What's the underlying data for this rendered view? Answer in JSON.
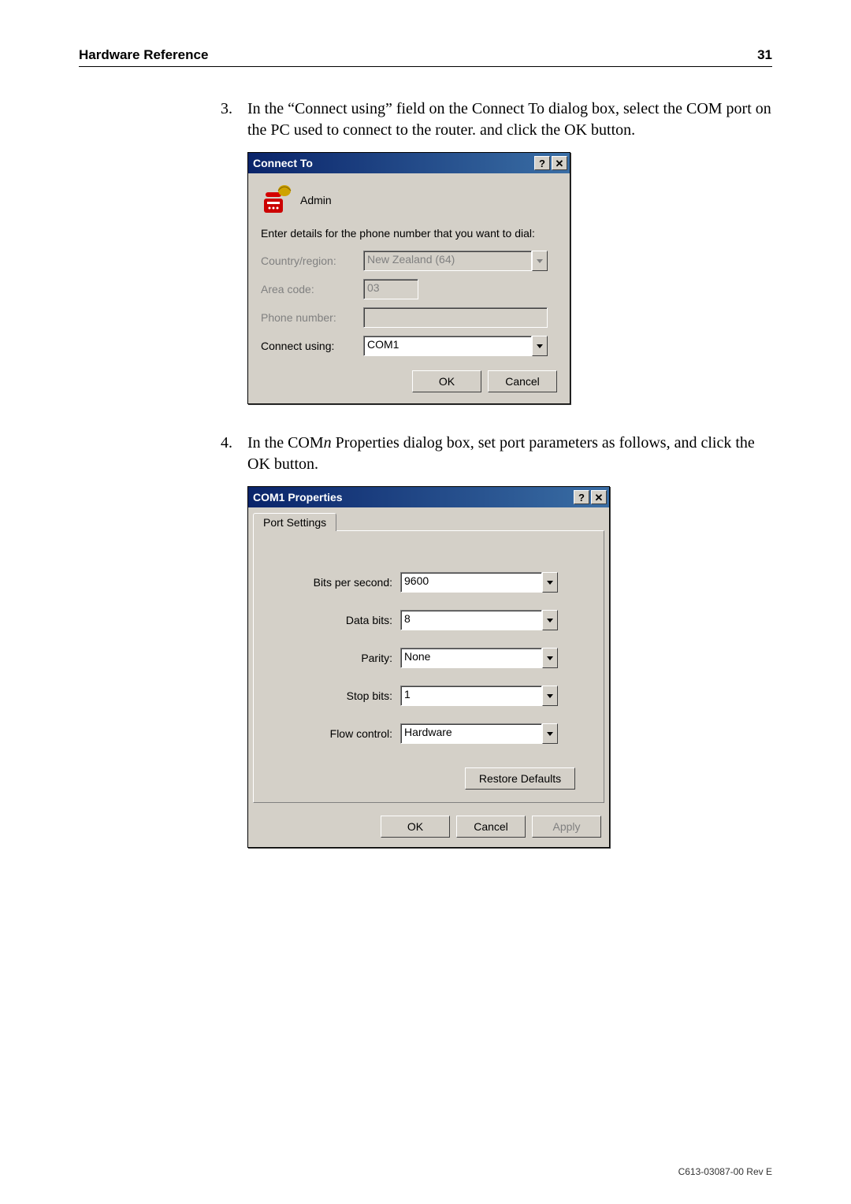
{
  "header": {
    "title": "Hardware Reference",
    "page_number": "31"
  },
  "steps": [
    {
      "number": "3.",
      "text": "In the “Connect using” field on the Connect To dialog box, select the COM port on the PC used to connect to the router. and click the OK button."
    },
    {
      "number": "4.",
      "text_prefix": "In the COM",
      "text_em": "n",
      "text_suffix": " Properties dialog box, set port parameters as follows, and click the OK button."
    }
  ],
  "connect_dialog": {
    "title": "Connect To",
    "icon_label": "Admin",
    "instruction": "Enter details for the phone number that you want to dial:",
    "fields": {
      "country_region": {
        "label": "Country/region:",
        "value": "New Zealand (64)"
      },
      "area_code": {
        "label": "Area code:",
        "value": "03"
      },
      "phone_number": {
        "label": "Phone number:",
        "value": ""
      },
      "connect_using": {
        "label": "Connect using:",
        "value": "COM1"
      }
    },
    "buttons": {
      "ok": "OK",
      "cancel": "Cancel"
    }
  },
  "com_props_dialog": {
    "title": "COM1 Properties",
    "tab": "Port Settings",
    "fields": {
      "bits_per_second": {
        "label": "Bits per second:",
        "value": "9600"
      },
      "data_bits": {
        "label": "Data bits:",
        "value": "8"
      },
      "parity": {
        "label": "Parity:",
        "value": "None"
      },
      "stop_bits": {
        "label": "Stop bits:",
        "value": "1"
      },
      "flow_control": {
        "label": "Flow control:",
        "value": "Hardware"
      }
    },
    "buttons": {
      "restore": "Restore Defaults",
      "ok": "OK",
      "cancel": "Cancel",
      "apply": "Apply"
    }
  },
  "footer": "C613-03087-00 Rev E"
}
